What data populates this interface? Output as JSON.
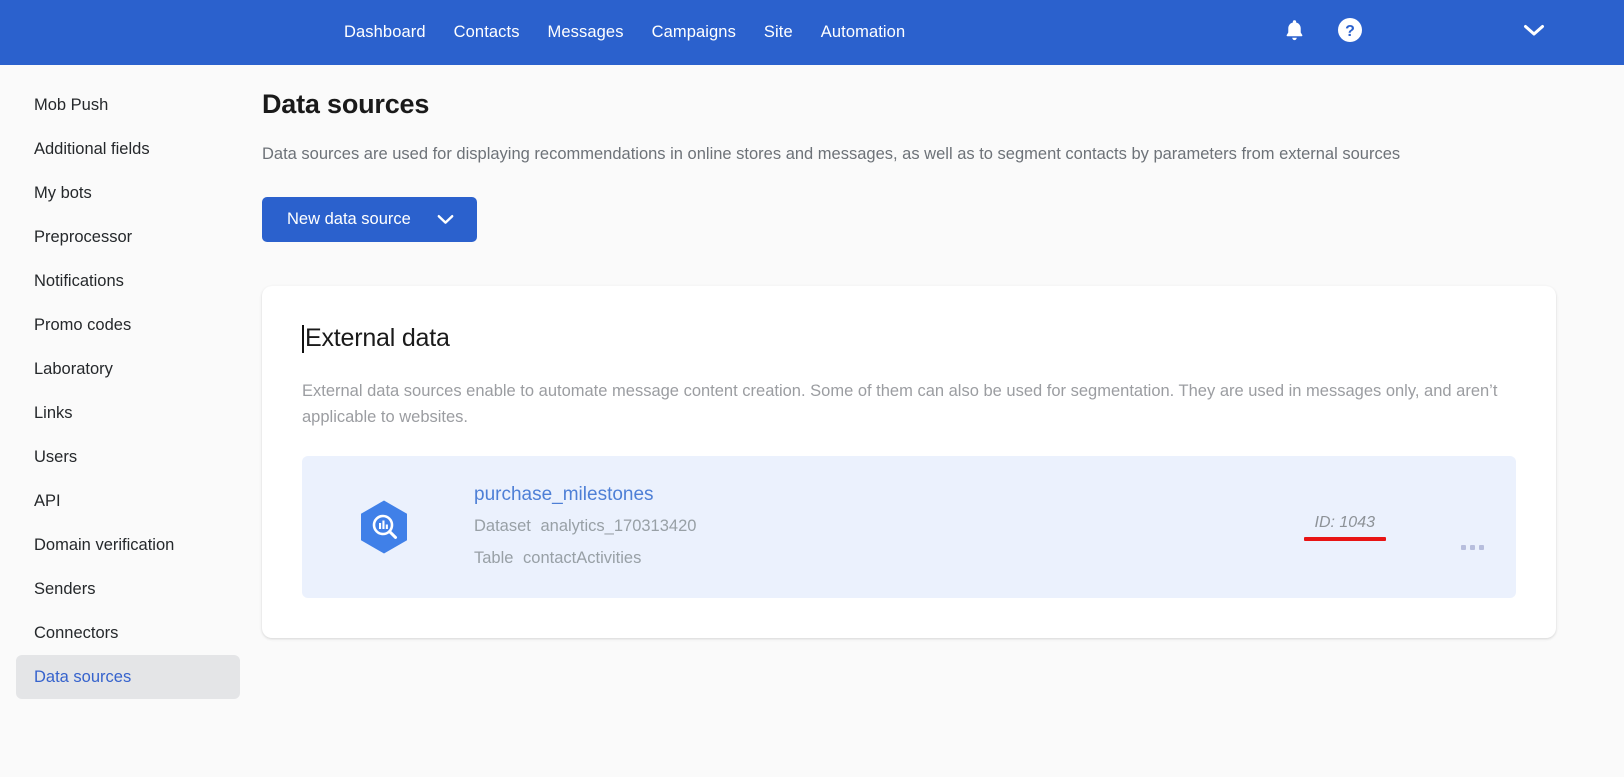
{
  "topnav": {
    "links": [
      {
        "label": "Dashboard",
        "name": "nav-dashboard"
      },
      {
        "label": "Contacts",
        "name": "nav-contacts"
      },
      {
        "label": "Messages",
        "name": "nav-messages"
      },
      {
        "label": "Campaigns",
        "name": "nav-campaigns"
      },
      {
        "label": "Site",
        "name": "nav-site"
      },
      {
        "label": "Automation",
        "name": "nav-automation"
      }
    ],
    "icons": {
      "notifications": "bell-icon",
      "help": "help-circle-icon",
      "account_menu": "chevron-down-icon"
    },
    "background_color": "#2b61cd"
  },
  "sidebar": {
    "items": [
      {
        "label": "Mob Push",
        "active": false
      },
      {
        "label": "Additional fields",
        "active": false
      },
      {
        "label": "My bots",
        "active": false
      },
      {
        "label": "Preprocessor",
        "active": false
      },
      {
        "label": "Notifications",
        "active": false
      },
      {
        "label": "Promo codes",
        "active": false
      },
      {
        "label": "Laboratory",
        "active": false
      },
      {
        "label": "Links",
        "active": false
      },
      {
        "label": "Users",
        "active": false
      },
      {
        "label": "API",
        "active": false
      },
      {
        "label": "Domain verification",
        "active": false
      },
      {
        "label": "Senders",
        "active": false
      },
      {
        "label": "Connectors",
        "active": false
      },
      {
        "label": "Data sources",
        "active": true
      }
    ],
    "active_color": "#3663cd",
    "active_background": "#e4e5e7"
  },
  "main": {
    "title": "Data sources",
    "description": "Data sources are used for displaying recommendations in online stores and messages, as well as to segment contacts by parameters from external sources",
    "new_button": {
      "label": "New data source",
      "chevron": "chevron-down-icon",
      "color": "#2b61cd"
    },
    "card": {
      "title": "External data",
      "description": "External data sources enable to automate message content creation. Some of them can also be used for segmentation. They are used in messages only, and aren’t applicable to websites.",
      "rows": [
        {
          "icon": "bigquery-hexagon-icon",
          "name": "purchase_milestones",
          "dataset_label": "Dataset",
          "dataset_value": "analytics_170313420",
          "table_label": "Table",
          "table_value": "contactActivities",
          "id_text": "ID: 1043",
          "id_highlight_color": "#e81414",
          "menu_icon": "kebab-menu-icon",
          "background": "#ebf1fd"
        }
      ]
    }
  }
}
